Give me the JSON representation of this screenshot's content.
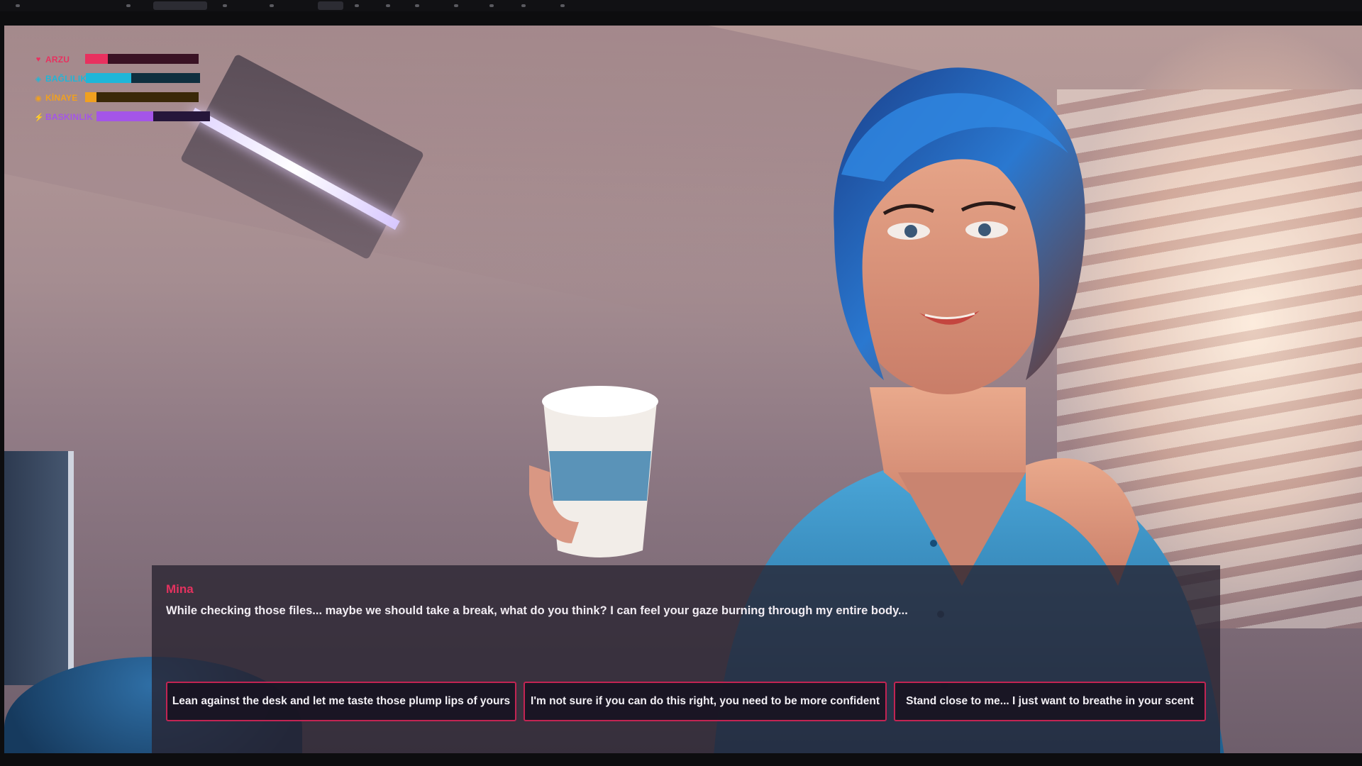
{
  "toolbar": {
    "icons": [
      "menu-icon",
      "user-icon",
      "chevron-icon",
      "status-icon",
      "record-icon",
      "window-icon",
      "text-tool-icon",
      "brush-icon",
      "pin-icon",
      "undo-icon",
      "minus-icon",
      "info-icon",
      "fullscreen-icon"
    ]
  },
  "stats": [
    {
      "label": "ARZU",
      "icon": "heart-icon",
      "glyph": "♥",
      "color": "#e8315f",
      "track": "#3a1224",
      "level": 0.2
    },
    {
      "label": "BAĞLILIK",
      "icon": "diamond-icon",
      "glyph": "◈",
      "color": "#1fb6d8",
      "track": "#0f2f3f",
      "level": 0.4
    },
    {
      "label": "KİNAYE",
      "icon": "target-icon",
      "glyph": "◉",
      "color": "#f0a020",
      "track": "#3a2808",
      "level": 0.1
    },
    {
      "label": "BASKINLIK",
      "icon": "lightning-icon",
      "glyph": "⚡",
      "color": "#a455e8",
      "track": "#26163a",
      "level": 0.5
    }
  ],
  "dialog": {
    "speaker": "Mina",
    "text": "While checking those files... maybe we should take a break, what do you think? I can feel your gaze burning through my entire body...",
    "speaker_color": "#e4325f"
  },
  "choices": [
    {
      "label": "Lean against the desk and let me taste those plump lips of yours"
    },
    {
      "label": "I'm not sure if you can do this right, you need to be more confident"
    },
    {
      "label": "Stand close to me... I just want to breathe in your scent"
    }
  ],
  "colors": {
    "choice_border": "#c22453",
    "dialog_bg": "#282230"
  }
}
